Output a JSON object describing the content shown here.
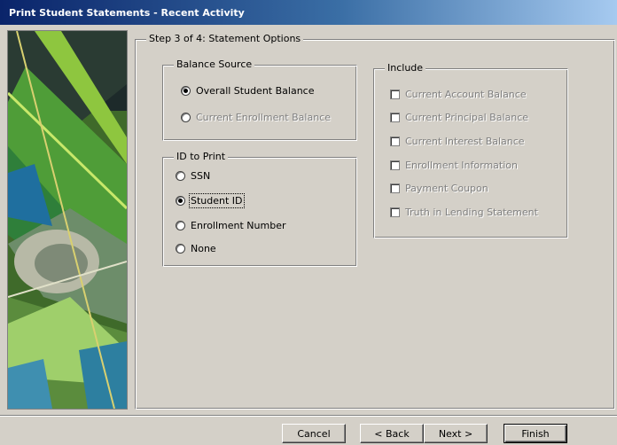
{
  "window": {
    "title": "Print Student Statements - Recent Activity"
  },
  "step": {
    "legend": "Step 3 of 4: Statement Options"
  },
  "balance_source": {
    "legend": "Balance Source",
    "options": [
      {
        "label": "Overall Student Balance",
        "checked": true
      },
      {
        "label": "Current Enrollment Balance",
        "checked": false
      }
    ]
  },
  "id_to_print": {
    "legend": "ID to Print",
    "options": [
      {
        "label": "SSN",
        "checked": false
      },
      {
        "label": "Student ID",
        "checked": true
      },
      {
        "label": "Enrollment Number",
        "checked": false
      },
      {
        "label": "None",
        "checked": false
      }
    ]
  },
  "include": {
    "legend": "Include",
    "items": [
      {
        "label": "Current Account Balance",
        "checked": false
      },
      {
        "label": "Current Principal Balance",
        "checked": false
      },
      {
        "label": "Current Interest Balance",
        "checked": false
      },
      {
        "label": "Enrollment Information",
        "checked": false
      },
      {
        "label": "Payment Coupon",
        "checked": false
      },
      {
        "label": "Truth in Lending Statement",
        "checked": false
      }
    ]
  },
  "buttons": {
    "cancel": "Cancel",
    "back": "< Back",
    "next": "Next >",
    "finish": "Finish"
  }
}
